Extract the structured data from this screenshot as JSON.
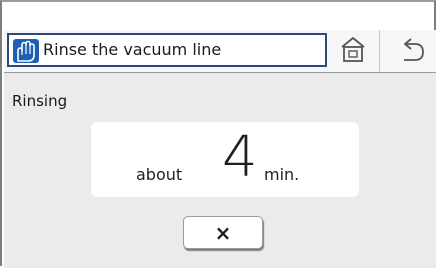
{
  "header": {
    "title": "Rinse the vacuum line",
    "app_icon": "hand-rinse-icon",
    "home_icon": "home-icon",
    "back_icon": "back-arrow-icon"
  },
  "status": {
    "text": "Rinsing"
  },
  "time_remaining": {
    "prefix": "about",
    "value": "4",
    "unit": "min."
  },
  "cancel_button": {
    "symbol": "×",
    "icon": "close-icon"
  },
  "colors": {
    "title_border": "#2a4a7c",
    "app_icon_bg": "#1e5fb4",
    "content_bg": "#ebebeb",
    "header_bg": "#f6f6f6"
  }
}
